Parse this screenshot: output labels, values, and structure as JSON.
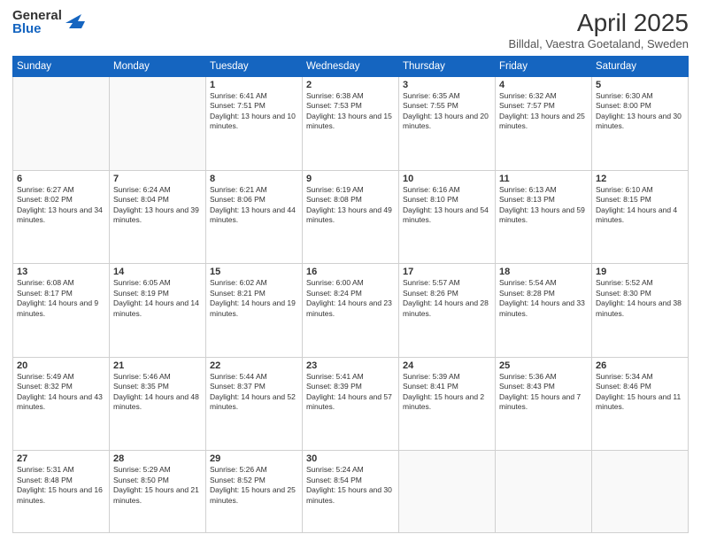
{
  "logo": {
    "general": "General",
    "blue": "Blue"
  },
  "title": "April 2025",
  "subtitle": "Billdal, Vaestra Goetaland, Sweden",
  "days_of_week": [
    "Sunday",
    "Monday",
    "Tuesday",
    "Wednesday",
    "Thursday",
    "Friday",
    "Saturday"
  ],
  "weeks": [
    [
      {
        "day": "",
        "info": ""
      },
      {
        "day": "",
        "info": ""
      },
      {
        "day": "1",
        "info": "Sunrise: 6:41 AM\nSunset: 7:51 PM\nDaylight: 13 hours and 10 minutes."
      },
      {
        "day": "2",
        "info": "Sunrise: 6:38 AM\nSunset: 7:53 PM\nDaylight: 13 hours and 15 minutes."
      },
      {
        "day": "3",
        "info": "Sunrise: 6:35 AM\nSunset: 7:55 PM\nDaylight: 13 hours and 20 minutes."
      },
      {
        "day": "4",
        "info": "Sunrise: 6:32 AM\nSunset: 7:57 PM\nDaylight: 13 hours and 25 minutes."
      },
      {
        "day": "5",
        "info": "Sunrise: 6:30 AM\nSunset: 8:00 PM\nDaylight: 13 hours and 30 minutes."
      }
    ],
    [
      {
        "day": "6",
        "info": "Sunrise: 6:27 AM\nSunset: 8:02 PM\nDaylight: 13 hours and 34 minutes."
      },
      {
        "day": "7",
        "info": "Sunrise: 6:24 AM\nSunset: 8:04 PM\nDaylight: 13 hours and 39 minutes."
      },
      {
        "day": "8",
        "info": "Sunrise: 6:21 AM\nSunset: 8:06 PM\nDaylight: 13 hours and 44 minutes."
      },
      {
        "day": "9",
        "info": "Sunrise: 6:19 AM\nSunset: 8:08 PM\nDaylight: 13 hours and 49 minutes."
      },
      {
        "day": "10",
        "info": "Sunrise: 6:16 AM\nSunset: 8:10 PM\nDaylight: 13 hours and 54 minutes."
      },
      {
        "day": "11",
        "info": "Sunrise: 6:13 AM\nSunset: 8:13 PM\nDaylight: 13 hours and 59 minutes."
      },
      {
        "day": "12",
        "info": "Sunrise: 6:10 AM\nSunset: 8:15 PM\nDaylight: 14 hours and 4 minutes."
      }
    ],
    [
      {
        "day": "13",
        "info": "Sunrise: 6:08 AM\nSunset: 8:17 PM\nDaylight: 14 hours and 9 minutes."
      },
      {
        "day": "14",
        "info": "Sunrise: 6:05 AM\nSunset: 8:19 PM\nDaylight: 14 hours and 14 minutes."
      },
      {
        "day": "15",
        "info": "Sunrise: 6:02 AM\nSunset: 8:21 PM\nDaylight: 14 hours and 19 minutes."
      },
      {
        "day": "16",
        "info": "Sunrise: 6:00 AM\nSunset: 8:24 PM\nDaylight: 14 hours and 23 minutes."
      },
      {
        "day": "17",
        "info": "Sunrise: 5:57 AM\nSunset: 8:26 PM\nDaylight: 14 hours and 28 minutes."
      },
      {
        "day": "18",
        "info": "Sunrise: 5:54 AM\nSunset: 8:28 PM\nDaylight: 14 hours and 33 minutes."
      },
      {
        "day": "19",
        "info": "Sunrise: 5:52 AM\nSunset: 8:30 PM\nDaylight: 14 hours and 38 minutes."
      }
    ],
    [
      {
        "day": "20",
        "info": "Sunrise: 5:49 AM\nSunset: 8:32 PM\nDaylight: 14 hours and 43 minutes."
      },
      {
        "day": "21",
        "info": "Sunrise: 5:46 AM\nSunset: 8:35 PM\nDaylight: 14 hours and 48 minutes."
      },
      {
        "day": "22",
        "info": "Sunrise: 5:44 AM\nSunset: 8:37 PM\nDaylight: 14 hours and 52 minutes."
      },
      {
        "day": "23",
        "info": "Sunrise: 5:41 AM\nSunset: 8:39 PM\nDaylight: 14 hours and 57 minutes."
      },
      {
        "day": "24",
        "info": "Sunrise: 5:39 AM\nSunset: 8:41 PM\nDaylight: 15 hours and 2 minutes."
      },
      {
        "day": "25",
        "info": "Sunrise: 5:36 AM\nSunset: 8:43 PM\nDaylight: 15 hours and 7 minutes."
      },
      {
        "day": "26",
        "info": "Sunrise: 5:34 AM\nSunset: 8:46 PM\nDaylight: 15 hours and 11 minutes."
      }
    ],
    [
      {
        "day": "27",
        "info": "Sunrise: 5:31 AM\nSunset: 8:48 PM\nDaylight: 15 hours and 16 minutes."
      },
      {
        "day": "28",
        "info": "Sunrise: 5:29 AM\nSunset: 8:50 PM\nDaylight: 15 hours and 21 minutes."
      },
      {
        "day": "29",
        "info": "Sunrise: 5:26 AM\nSunset: 8:52 PM\nDaylight: 15 hours and 25 minutes."
      },
      {
        "day": "30",
        "info": "Sunrise: 5:24 AM\nSunset: 8:54 PM\nDaylight: 15 hours and 30 minutes."
      },
      {
        "day": "",
        "info": ""
      },
      {
        "day": "",
        "info": ""
      },
      {
        "day": "",
        "info": ""
      }
    ]
  ]
}
